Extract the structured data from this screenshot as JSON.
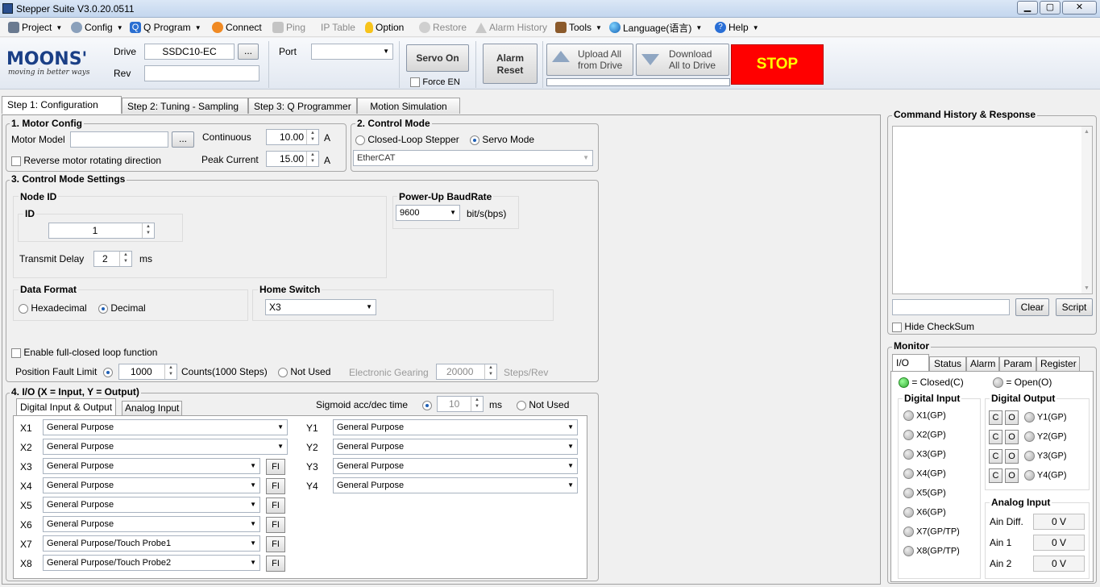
{
  "window": {
    "title": "Stepper Suite V3.0.20.0511",
    "min": "▁",
    "max": "▢",
    "close": "✕"
  },
  "menu": [
    {
      "label": "Project",
      "icon": "project-icon",
      "dropdown": true,
      "disabled": false
    },
    {
      "label": "Config",
      "icon": "config-gear-icon",
      "dropdown": true,
      "disabled": false
    },
    {
      "label": "Q Program",
      "icon": "q-program-icon",
      "dropdown": true,
      "disabled": false
    },
    {
      "label": "Connect",
      "icon": "connect-icon",
      "dropdown": false,
      "disabled": false
    },
    {
      "label": "Ping",
      "icon": "ping-icon",
      "dropdown": false,
      "disabled": true
    },
    {
      "label": "IP Table",
      "icon": "ip-table-icon",
      "dropdown": false,
      "disabled": true
    },
    {
      "label": "Option",
      "icon": "lightbulb-icon",
      "dropdown": false,
      "disabled": false
    },
    {
      "label": "Restore",
      "icon": "restore-icon",
      "dropdown": false,
      "disabled": true
    },
    {
      "label": "Alarm History",
      "icon": "warning-icon",
      "dropdown": false,
      "disabled": true
    },
    {
      "label": "Tools",
      "icon": "tools-icon",
      "dropdown": true,
      "disabled": false
    },
    {
      "label": "Language(语言)",
      "icon": "globe-icon",
      "dropdown": true,
      "disabled": false
    },
    {
      "label": "Help",
      "icon": "help-icon",
      "dropdown": true,
      "disabled": false
    }
  ],
  "toolbar": {
    "logo": "MOONS'",
    "slogan": "moving in better ways",
    "drive_label": "Drive",
    "drive_value": "SSDC10-EC",
    "browse": "...",
    "rev_label": "Rev",
    "rev_value": "",
    "port_label": "Port",
    "port_value": "",
    "servo_on": "Servo On",
    "force_en": "Force EN",
    "alarm_reset_1": "Alarm",
    "alarm_reset_2": "Reset",
    "upload_1": "Upload All",
    "upload_2": "from Drive",
    "download_1": "Download",
    "download_2": "All to Drive",
    "stop": "STOP"
  },
  "tabs": [
    "Step 1: Configuration",
    "Step 2: Tuning - Sampling",
    "Step 3: Q Programmer",
    "Motion Simulation"
  ],
  "motor": {
    "title": "1. Motor Config",
    "model_label": "Motor Model",
    "model_value": "",
    "browse": "...",
    "reverse": "Reverse motor rotating direction",
    "cont_label": "Continuous",
    "cont_value": "10.00",
    "cont_unit": "A",
    "peak_label": "Peak Current",
    "peak_value": "15.00",
    "peak_unit": "A"
  },
  "control": {
    "title": "2. Control Mode",
    "closed_loop": "Closed-Loop Stepper",
    "servo": "Servo Mode",
    "bus": "EtherCAT"
  },
  "settings": {
    "title": "3. Control Mode Settings",
    "node_title": "Node ID",
    "id_title": "ID",
    "id_value": "1",
    "delay_label": "Transmit Delay",
    "delay_value": "2",
    "delay_unit": "ms",
    "baud_title": "Power-Up BaudRate",
    "baud_value": "9600",
    "baud_unit": "bit/s(bps)",
    "format_title": "Data Format",
    "hex": "Hexadecimal",
    "dec": "Decimal",
    "home_title": "Home Switch",
    "home_value": "X3",
    "fullclosed": "Enable full-closed loop function",
    "pfl_label": "Position Fault Limit",
    "pfl_value": "1000",
    "pfl_unit": "Counts(1000 Steps)",
    "not_used": "Not Used",
    "egear_label": "Electronic Gearing",
    "egear_value": "20000",
    "egear_unit": "Steps/Rev"
  },
  "io": {
    "title": "4. I/O (X = Input, Y = Output)",
    "tab_digital": "Digital Input & Output",
    "tab_analog": "Analog Input",
    "sigmoid_label": "Sigmoid acc/dec time",
    "sigmoid_value": "10",
    "sigmoid_unit": "ms",
    "not_used": "Not Used",
    "fi": "FI",
    "inputs": [
      {
        "name": "X1",
        "value": "General Purpose",
        "fi": false
      },
      {
        "name": "X2",
        "value": "General Purpose",
        "fi": false
      },
      {
        "name": "X3",
        "value": "General Purpose",
        "fi": true
      },
      {
        "name": "X4",
        "value": "General Purpose",
        "fi": true
      },
      {
        "name": "X5",
        "value": "General Purpose",
        "fi": true
      },
      {
        "name": "X6",
        "value": "General Purpose",
        "fi": true
      },
      {
        "name": "X7",
        "value": "General Purpose/Touch Probe1",
        "fi": true
      },
      {
        "name": "X8",
        "value": "General Purpose/Touch Probe2",
        "fi": true
      }
    ],
    "outputs": [
      {
        "name": "Y1",
        "value": "General Purpose"
      },
      {
        "name": "Y2",
        "value": "General Purpose"
      },
      {
        "name": "Y3",
        "value": "General Purpose"
      },
      {
        "name": "Y4",
        "value": "General Purpose"
      }
    ]
  },
  "history": {
    "title": "Command History & Response",
    "clear": "Clear",
    "script": "Script",
    "hide_checksum": "Hide CheckSum",
    "input_value": ""
  },
  "monitor": {
    "title": "Monitor",
    "tabs": [
      "I/O",
      "Status",
      "Alarm",
      "Param",
      "Register"
    ],
    "closed": "= Closed(C)",
    "open": "= Open(O)",
    "di_title": "Digital Input",
    "do_title": "Digital Output",
    "di": [
      "X1(GP)",
      "X2(GP)",
      "X3(GP)",
      "X4(GP)",
      "X5(GP)",
      "X6(GP)",
      "X7(GP/TP)",
      "X8(GP/TP)"
    ],
    "do": [
      "Y1(GP)",
      "Y2(GP)",
      "Y3(GP)",
      "Y4(GP)"
    ],
    "c": "C",
    "o": "O",
    "ai_title": "Analog Input",
    "ai": [
      {
        "label": "Ain Diff.",
        "value": "0 V"
      },
      {
        "label": "Ain 1",
        "value": "0 V"
      },
      {
        "label": "Ain 2",
        "value": "0 V"
      }
    ]
  },
  "colors": {
    "stop_bg": "#ff0000",
    "stop_fg": "#ffff00",
    "logo": "#1a3f86",
    "led_on": "#33aa33"
  }
}
